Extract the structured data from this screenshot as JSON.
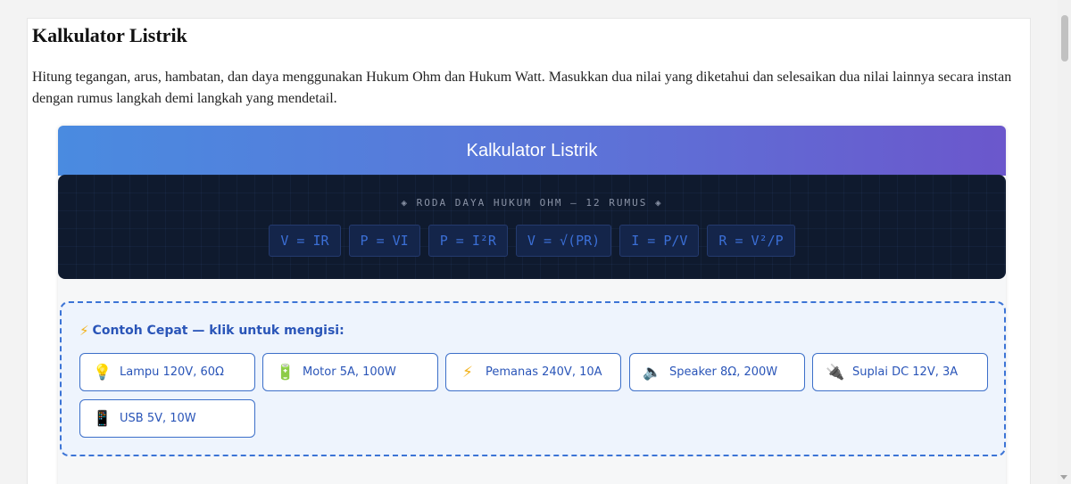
{
  "page": {
    "title": "Kalkulator Listrik",
    "intro": "Hitung tegangan, arus, hambatan, dan daya menggunakan Hukum Ohm dan Hukum Watt. Masukkan dua nilai yang diketahui dan selesaikan dua nilai lainnya secara instan dengan rumus langkah demi langkah yang mendetail."
  },
  "calculator": {
    "title": "Kalkulator Listrik",
    "wheel": {
      "caption": "◈ RODA DAYA HUKUM OHM — 12 RUMUS ◈",
      "formulas": [
        "V = IR",
        "P = VI",
        "P = I²R",
        "V = √(PR)",
        "I = P/V",
        "R = V²/P"
      ]
    },
    "examples": {
      "title": "Contoh Cepat — klik untuk mengisi:",
      "title_icon": "lightning-icon",
      "items": [
        {
          "label": "Lampu 120V, 60Ω",
          "icon": "lightbulb-icon",
          "glyph": "💡"
        },
        {
          "label": "Motor 5A, 100W",
          "icon": "battery-icon",
          "glyph": "🔋"
        },
        {
          "label": "Pemanas 240V, 10A",
          "icon": "lightning-icon",
          "glyph": "⚡"
        },
        {
          "label": "Speaker 8Ω, 200W",
          "icon": "speaker-icon",
          "glyph": "🔈"
        },
        {
          "label": "Suplai DC 12V, 3A",
          "icon": "plug-icon",
          "glyph": "🔌"
        },
        {
          "label": "USB 5V, 10W",
          "icon": "mobile-phone-icon",
          "glyph": "📱"
        }
      ]
    },
    "colors": {
      "header_start": "#4a8be0",
      "header_end": "#6b57cc",
      "wheel_bg": "#0f1a2e",
      "formula_text": "#3b6fd6",
      "accent": "#2a55b8",
      "examples_bg": "#eef4fd"
    }
  }
}
